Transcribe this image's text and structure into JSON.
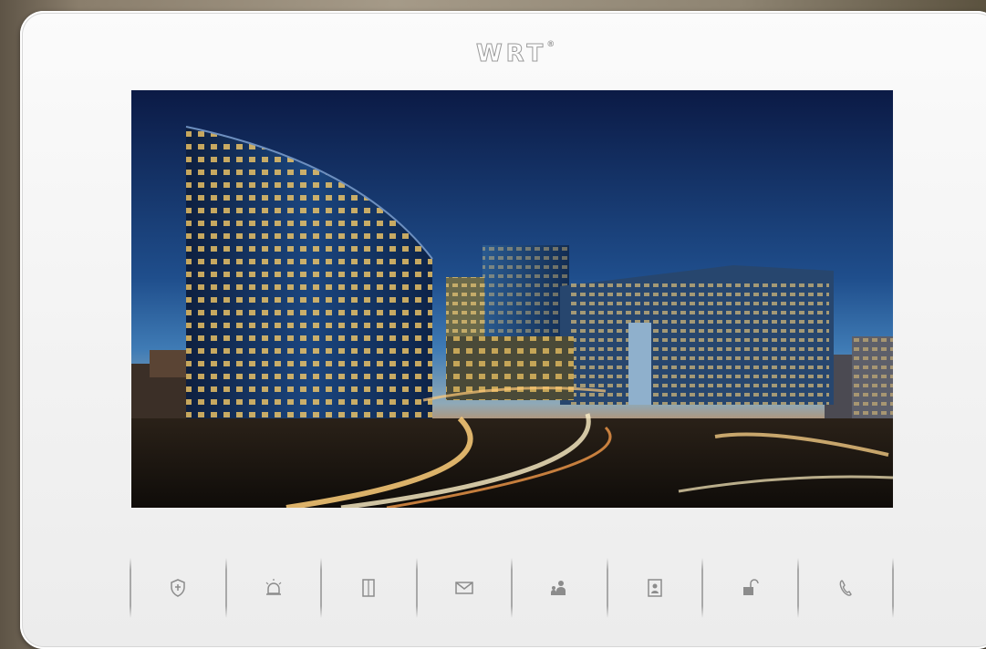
{
  "device": {
    "brand": "WRT",
    "brand_mark": "®"
  },
  "screen": {
    "wallpaper": "night-city-office-buildings"
  },
  "buttons": [
    {
      "icon": "shield-icon",
      "action": "security"
    },
    {
      "icon": "alarm-bell-icon",
      "action": "alarm"
    },
    {
      "icon": "door-icon",
      "action": "door"
    },
    {
      "icon": "envelope-icon",
      "action": "message"
    },
    {
      "icon": "intercom-people-icon",
      "action": "intercom"
    },
    {
      "icon": "contact-card-icon",
      "action": "contacts"
    },
    {
      "icon": "unlock-icon",
      "action": "unlock"
    },
    {
      "icon": "phone-icon",
      "action": "call"
    }
  ],
  "colors": {
    "bezel": "#f4f4f4",
    "icon": "#8c8c8c",
    "sky_top": "#0c1b44",
    "sky_horizon": "#c77a3b"
  }
}
